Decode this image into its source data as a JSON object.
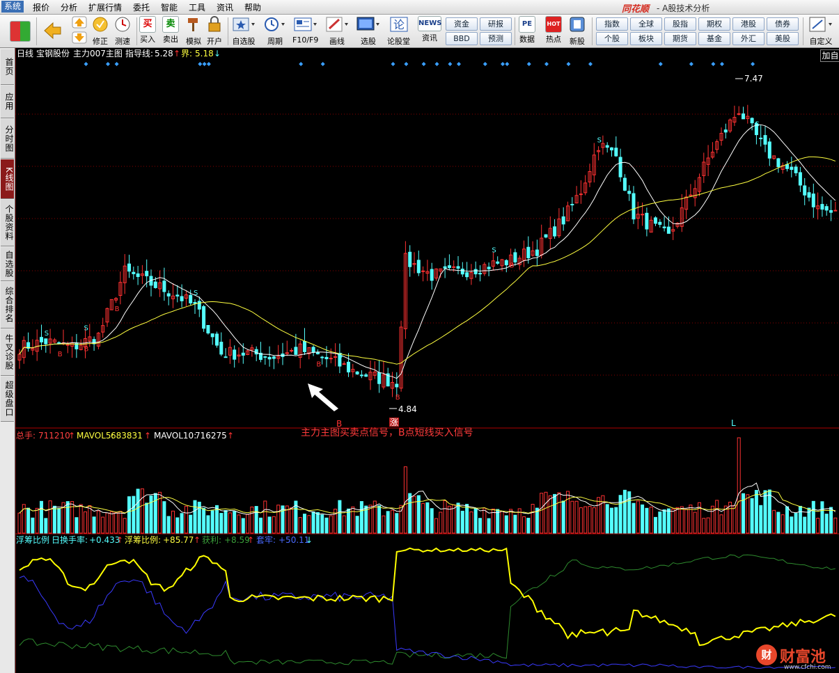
{
  "menu": {
    "items": [
      "系统",
      "报价",
      "分析",
      "扩展行情",
      "委托",
      "智能",
      "工具",
      "资讯",
      "帮助"
    ],
    "brand": "同花顺",
    "app_title": "- A股技术分析"
  },
  "toolbar": {
    "buttons": [
      "修正",
      "测速",
      "买入",
      "卖出",
      "模拟",
      "开户",
      "自选股",
      "周期",
      "F10/F9",
      "画线",
      "选股",
      "论股堂",
      "资讯",
      "数据",
      "热点",
      "新股",
      "自定义"
    ],
    "button_glyphs": {
      "buy": "买",
      "sell": "卖",
      "news": "NEWS",
      "f10": "F10",
      "pe": "PE",
      "hot": "HOT"
    },
    "quick_row1": [
      "资金",
      "研报",
      "指数",
      "全球",
      "股指",
      "期权",
      "港股",
      "债券"
    ],
    "quick_row2": [
      "BBD",
      "预测",
      "个股",
      "板块",
      "期货",
      "基金",
      "外汇",
      "美股"
    ]
  },
  "left_tabs": [
    "首页",
    "应用",
    "分时图",
    "K线图",
    "个股资料",
    "自选股",
    "综合排名",
    "牛叉诊股",
    "超级盘口"
  ],
  "left_tabs_active": "K线图",
  "kline_header": {
    "period": "日线",
    "stock_name": "宝钢股份",
    "indicator_name": "主力007主图",
    "guide_label": "指导线:",
    "guide_value": "5.28",
    "jie_label": "界:",
    "jie_value": "5.18"
  },
  "price_labels": {
    "high": "7.47",
    "low": "4.84"
  },
  "signal_labels": {
    "b": "B",
    "s": "S",
    "zhang": "涨",
    "l": "L"
  },
  "add_button": "加自",
  "volume_header": {
    "total_label": "总手:",
    "total_value": "711210",
    "mavol5_label": "MAVOL5:",
    "mavol5_value": "683831",
    "mavol10_label": "MAVOL10:",
    "mavol10_value": "716275"
  },
  "chip_header": {
    "title": "浮筹比例",
    "turnover_label": "日换手率:",
    "turnover_value": "+0.433",
    "float_label": "浮筹比例:",
    "float_value": "+85.77",
    "profit_label": "获利:",
    "profit_value": "+8.59",
    "trapped_label": "套牢:",
    "trapped_value": "+50.11"
  },
  "annotation": "主力主图买卖点信号，B点短线买入信号",
  "watermark": {
    "icon": "财",
    "text": "财富池",
    "url": "www.cfchi.com"
  },
  "colors": {
    "up": "#ff3232",
    "down": "#54ffff",
    "ma_white": "#ffffff",
    "ma_yellow": "#ffff40",
    "chip_yellow": "#ffff00",
    "chip_blue": "#3a3aff",
    "chip_green": "#2e8b2e",
    "signal_blue": "#3aa0ff",
    "grid": "#8b0000"
  },
  "chart_data": {
    "type": "candlestick",
    "price_range": [
      4.6,
      7.6
    ],
    "close_series_anchors": [
      [
        0,
        5.2
      ],
      [
        6,
        5.25
      ],
      [
        12,
        5.2
      ],
      [
        18,
        5.3
      ],
      [
        24,
        5.85
      ],
      [
        30,
        5.75
      ],
      [
        36,
        5.65
      ],
      [
        40,
        5.55
      ],
      [
        46,
        5.15
      ],
      [
        52,
        5.15
      ],
      [
        58,
        5.12
      ],
      [
        64,
        5.18
      ],
      [
        70,
        5.1
      ],
      [
        76,
        5.0
      ],
      [
        80,
        4.95
      ],
      [
        86,
        4.9
      ],
      [
        88,
        5.95
      ],
      [
        94,
        5.82
      ],
      [
        100,
        5.85
      ],
      [
        106,
        5.9
      ],
      [
        112,
        5.95
      ],
      [
        118,
        6.05
      ],
      [
        124,
        6.3
      ],
      [
        128,
        6.55
      ],
      [
        132,
        6.95
      ],
      [
        136,
        6.85
      ],
      [
        140,
        6.35
      ],
      [
        144,
        6.25
      ],
      [
        148,
        6.15
      ],
      [
        152,
        6.45
      ],
      [
        158,
        6.9
      ],
      [
        164,
        7.25
      ],
      [
        170,
        6.9
      ],
      [
        176,
        6.7
      ],
      [
        182,
        6.4
      ],
      [
        186,
        6.35
      ]
    ],
    "volume_range": [
      0,
      2300000
    ],
    "chip_range": [
      0,
      100
    ]
  }
}
